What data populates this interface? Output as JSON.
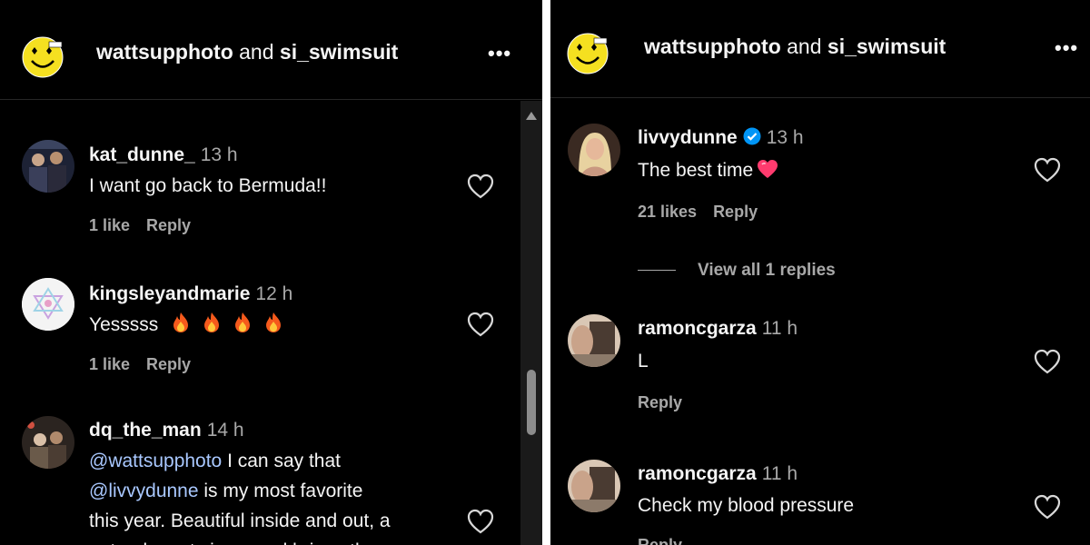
{
  "left": {
    "header": {
      "user1": "wattsupphoto",
      "and": "and",
      "user2": "si_swimsuit",
      "more": "•••"
    },
    "comments": [
      {
        "username": "kat_dunne_",
        "time": "13 h",
        "text": "I want go back to Bermuda!!",
        "likes": "1 like",
        "reply": "Reply"
      },
      {
        "username": "kingsleyandmarie",
        "time": "12 h",
        "text": "Yesssss",
        "emoji": [
          "fire",
          "fire",
          "fire",
          "fire"
        ],
        "likes": "1 like",
        "reply": "Reply"
      },
      {
        "username": "dq_the_man",
        "time": "14 h",
        "mention1": "@wattsupphoto",
        "text1": " I can say that",
        "mention2": "@livvydunne",
        "text2": " is my most favorite",
        "text3": "this year. Beautiful inside and out, a",
        "text4": "natural sports icon, and brings the"
      }
    ]
  },
  "right": {
    "header": {
      "user1": "wattsupphoto",
      "and": "and",
      "user2": "si_swimsuit",
      "more": "•••"
    },
    "comments": [
      {
        "username": "livvydunne",
        "verified": true,
        "time": "13 h",
        "text": "The best time",
        "emoji": "heart",
        "likes": "21 likes",
        "reply": "Reply"
      },
      {
        "username": "ramoncgarza",
        "time": "11 h",
        "text": "L",
        "reply": "Reply"
      },
      {
        "username": "ramoncgarza",
        "time": "11 h",
        "text": "Check my blood pressure",
        "reply": "Reply"
      }
    ],
    "view_replies": "View all 1 replies"
  },
  "colors": {
    "background": "#000000",
    "text": "#f5f5f5",
    "secondary": "#a8a8a8",
    "verified": "#0095f6",
    "logo": "#f5e020"
  }
}
